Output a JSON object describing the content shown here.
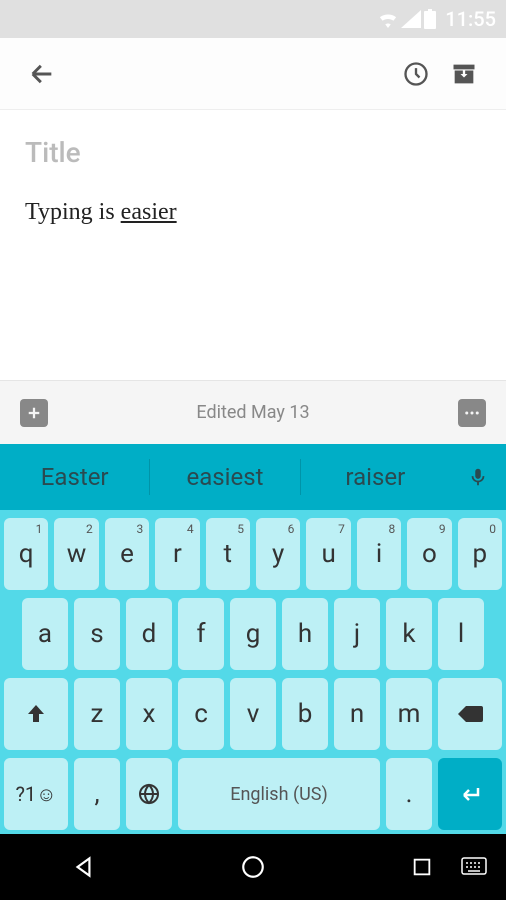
{
  "status": {
    "time": "11:55"
  },
  "app_bar": {},
  "note": {
    "title_placeholder": "Title",
    "body_prefix": "Typing is ",
    "body_underlined": "easier"
  },
  "footer": {
    "edited_label": "Edited May 13"
  },
  "keyboard": {
    "suggestions": [
      "Easter",
      "easiest",
      "raiser"
    ],
    "row1": [
      {
        "k": "q",
        "n": "1"
      },
      {
        "k": "w",
        "n": "2"
      },
      {
        "k": "e",
        "n": "3"
      },
      {
        "k": "r",
        "n": "4"
      },
      {
        "k": "t",
        "n": "5"
      },
      {
        "k": "y",
        "n": "6"
      },
      {
        "k": "u",
        "n": "7"
      },
      {
        "k": "i",
        "n": "8"
      },
      {
        "k": "o",
        "n": "9"
      },
      {
        "k": "p",
        "n": "0"
      }
    ],
    "row2": [
      "a",
      "s",
      "d",
      "f",
      "g",
      "h",
      "j",
      "k",
      "l"
    ],
    "row3": [
      "z",
      "x",
      "c",
      "v",
      "b",
      "n",
      "m"
    ],
    "space_label": "English (US)",
    "sym_label": "?1☺",
    "comma": ",",
    "period": "."
  }
}
